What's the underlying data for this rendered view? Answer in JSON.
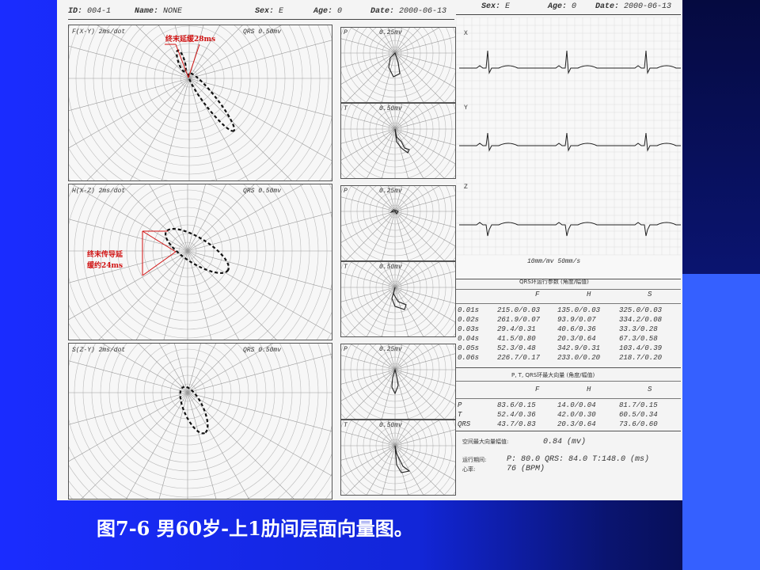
{
  "header_left": {
    "id_label": "ID:",
    "id_value": "004-1",
    "name_label": "Name:",
    "name_value": "NONE",
    "sex_label": "Sex:",
    "sex_value": "E",
    "age_label": "Age:",
    "age_value": "0",
    "date_label": "Date:",
    "date_value": "2000-06-13"
  },
  "header_right": {
    "sex_label": "Sex:",
    "sex_value": "E",
    "age_label": "Age:",
    "age_value": "0",
    "date_label": "Date:",
    "date_value": "2000-06-13"
  },
  "loops": [
    {
      "title": "F(X-Y) 2ms/dot",
      "qrs": "QRS",
      "scale": "0.50mv",
      "p_label": "P",
      "p_scale": "0.25mv",
      "t_label": "T",
      "t_scale": "0.50mv"
    },
    {
      "title": "H(X-Z) 2ms/dot",
      "qrs": "QRS",
      "scale": "0.50mv",
      "p_label": "P",
      "p_scale": "0.25mv",
      "t_label": "T",
      "t_scale": "0.50mv"
    },
    {
      "title": "S(Z-Y) 2ms/dot",
      "qrs": "QRS",
      "scale": "0.50mv",
      "p_label": "P",
      "p_scale": "0.25mv",
      "t_label": "T",
      "t_scale": "0.50mv"
    }
  ],
  "annotations": {
    "frontal": "终末延缓28ms",
    "horizontal_line1": "终末传导延",
    "horizontal_line2": "缓约24ms"
  },
  "ecg": {
    "leads": [
      "X",
      "Y",
      "Z"
    ],
    "speed": "10mm/mv  50mm/s"
  },
  "qrs_table": {
    "title": "QRS环运行参数 (角度/幅值)",
    "cols": [
      "F",
      "H",
      "S"
    ],
    "rows": [
      [
        "0.01s",
        "215.0/0.03",
        "135.0/0.03",
        "325.0/0.03"
      ],
      [
        "0.02s",
        "261.9/0.07",
        "93.9/0.07",
        "334.2/0.08"
      ],
      [
        "0.03s",
        "29.4/0.31",
        "40.6/0.36",
        "33.3/0.28"
      ],
      [
        "0.04s",
        "41.5/0.80",
        "20.3/0.64",
        "67.3/0.58"
      ],
      [
        "0.05s",
        "52.3/0.48",
        "342.9/0.31",
        "103.4/0.39"
      ],
      [
        "0.06s",
        "226.7/0.17",
        "233.0/0.20",
        "218.7/0.20"
      ]
    ]
  },
  "max_table": {
    "title": "P, T, QRS环最大向量 (角度/幅值)",
    "cols": [
      "F",
      "H",
      "S"
    ],
    "rows": [
      [
        "P",
        "83.6/0.15",
        "14.0/0.04",
        "81.7/0.15"
      ],
      [
        "T",
        "52.4/0.36",
        "42.0/0.30",
        "60.5/0.34"
      ],
      [
        "QRS",
        "43.7/0.83",
        "20.3/0.64",
        "73.6/0.60"
      ]
    ]
  },
  "summary": {
    "space_label": "空间最大向量幅值:",
    "space_value": "0.84  (mv)",
    "time_label": "运行期间:",
    "time_value": "P: 80.0  QRS: 84.0  T:148.0 (ms)",
    "hr_label": "心率:",
    "hr_value": "76  (BPM)"
  },
  "caption": "图7-6  男60岁-上1肋间层面向量图。"
}
